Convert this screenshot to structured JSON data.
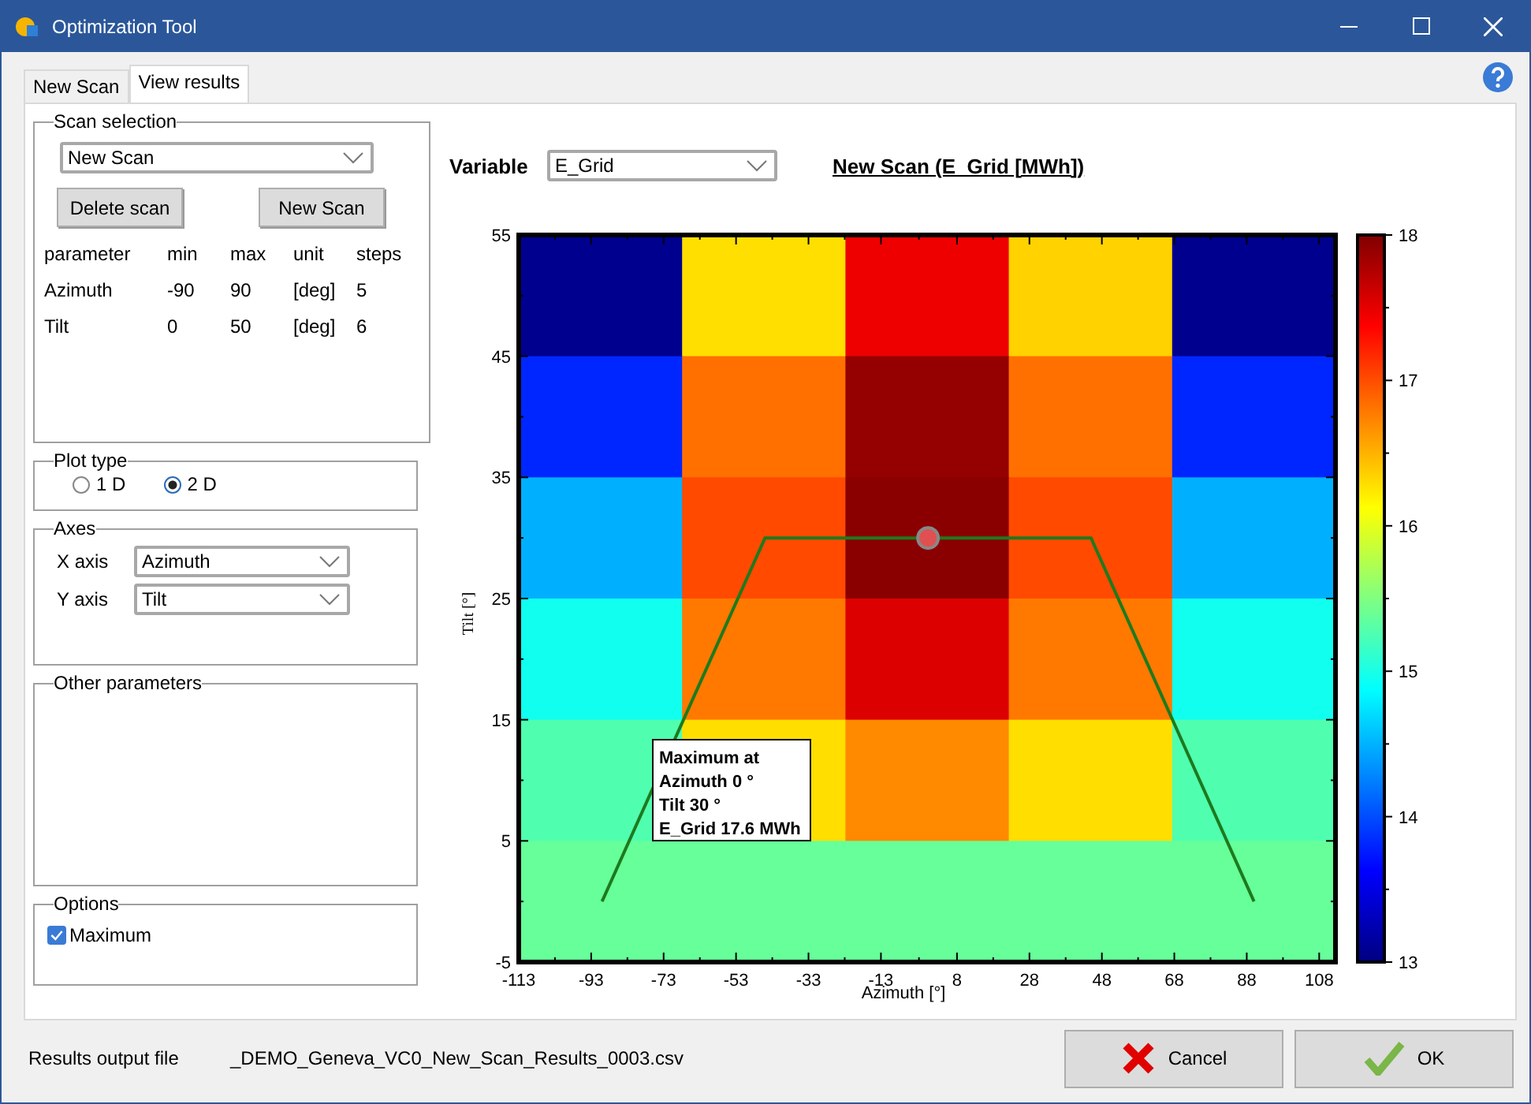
{
  "window": {
    "title": "Optimization Tool"
  },
  "tabs": [
    {
      "label": "New Scan",
      "selected": false
    },
    {
      "label": "View results",
      "selected": true
    }
  ],
  "scan_selection": {
    "title": "Scan selection",
    "scan": "New Scan",
    "buttons": [
      "Delete scan",
      "New Scan"
    ],
    "columns": [
      "parameter",
      "min",
      "max",
      "unit",
      "steps"
    ],
    "rows": [
      [
        "Azimuth",
        "-90",
        "90",
        "[deg]",
        "5"
      ],
      [
        "Tilt",
        "0",
        "50",
        "[deg]",
        "6"
      ]
    ]
  },
  "plot_type": {
    "title": "Plot type",
    "options": [
      {
        "label": "1 D",
        "selected": false
      },
      {
        "label": "2 D",
        "selected": true
      }
    ]
  },
  "axes": {
    "title": "Axes",
    "fields": [
      {
        "label": "X axis",
        "value": "Azimuth"
      },
      {
        "label": "Y axis",
        "value": "Tilt"
      }
    ]
  },
  "other_parameters": {
    "title": "Other parameters"
  },
  "options": {
    "title": "Options",
    "items": [
      {
        "label": "Maximum",
        "checked": true
      }
    ]
  },
  "variable": {
    "label": "Variable",
    "value": "E_Grid"
  },
  "plot": {
    "title": "New Scan (E_Grid [MWh])",
    "chart_data": {
      "type": "line",
      "xlabel": "Azimuth [°]",
      "ylabel": "Tilt [°]",
      "x": [
        -90,
        -45,
        0,
        45,
        90
      ],
      "series": [
        {
          "color": "#1e7a1e",
          "values": [
            0,
            30,
            null,
            30,
            0
          ]
        },
        {
          "color": "#e05050",
          "marker": true,
          "values": [
            null,
            null,
            30,
            null,
            null
          ]
        }
      ],
      "xlim": [
        -113,
        112.5
      ],
      "ylim": [
        -5,
        55
      ],
      "xticks": [
        -113,
        -93,
        -73,
        -53,
        -33,
        -13,
        8,
        28,
        48,
        68,
        88,
        108
      ],
      "yticks": [
        -5,
        5,
        15,
        25,
        35,
        45,
        55
      ]
    },
    "heatmap_rows": [
      [
        {
          "color": "#00008f"
        },
        {
          "color": "#ffdf00"
        },
        {
          "color": "#ee0000"
        },
        {
          "color": "#ffd200"
        },
        {
          "color": "#00008f"
        }
      ],
      [
        {
          "color": "#0026ff"
        },
        {
          "color": "#ff7000"
        },
        {
          "color": "#950000"
        },
        {
          "color": "#ff7000"
        },
        {
          "color": "#0026ff"
        }
      ],
      [
        {
          "color": "#00b0ff"
        },
        {
          "color": "#ff4a00"
        },
        {
          "color": "#8a0000"
        },
        {
          "color": "#ff4a00"
        },
        {
          "color": "#00b0ff"
        }
      ],
      [
        {
          "color": "#10ffef"
        },
        {
          "color": "#ff7800"
        },
        {
          "color": "#dd0000"
        },
        {
          "color": "#ff7800"
        },
        {
          "color": "#10ffef"
        }
      ],
      [
        {
          "color": "#4fffaf"
        },
        {
          "color": "#ffde00"
        },
        {
          "color": "#ff8a00"
        },
        {
          "color": "#ffde00"
        },
        {
          "color": "#4fffaf"
        }
      ],
      [
        {
          "color": "#66ff99"
        },
        {
          "color": "#66ff99"
        },
        {
          "color": "#66ff99"
        },
        {
          "color": "#66ff99"
        },
        {
          "color": "#66ff99"
        }
      ]
    ],
    "colorbar_ticks": [
      "18",
      "17",
      "16",
      "15",
      "14",
      "13"
    ],
    "tooltip": [
      "Maximum at",
      "Azimuth 0 °",
      "Tilt 30 °",
      "E_Grid 17.6 MWh"
    ]
  },
  "output_file": {
    "label": "Results output file",
    "value": "_DEMO_Geneva_VC0_New_Scan_Results_0003.csv"
  },
  "buttons": [
    {
      "label": "Cancel",
      "kind": "cancel"
    },
    {
      "label": "OK",
      "kind": "ok"
    }
  ]
}
